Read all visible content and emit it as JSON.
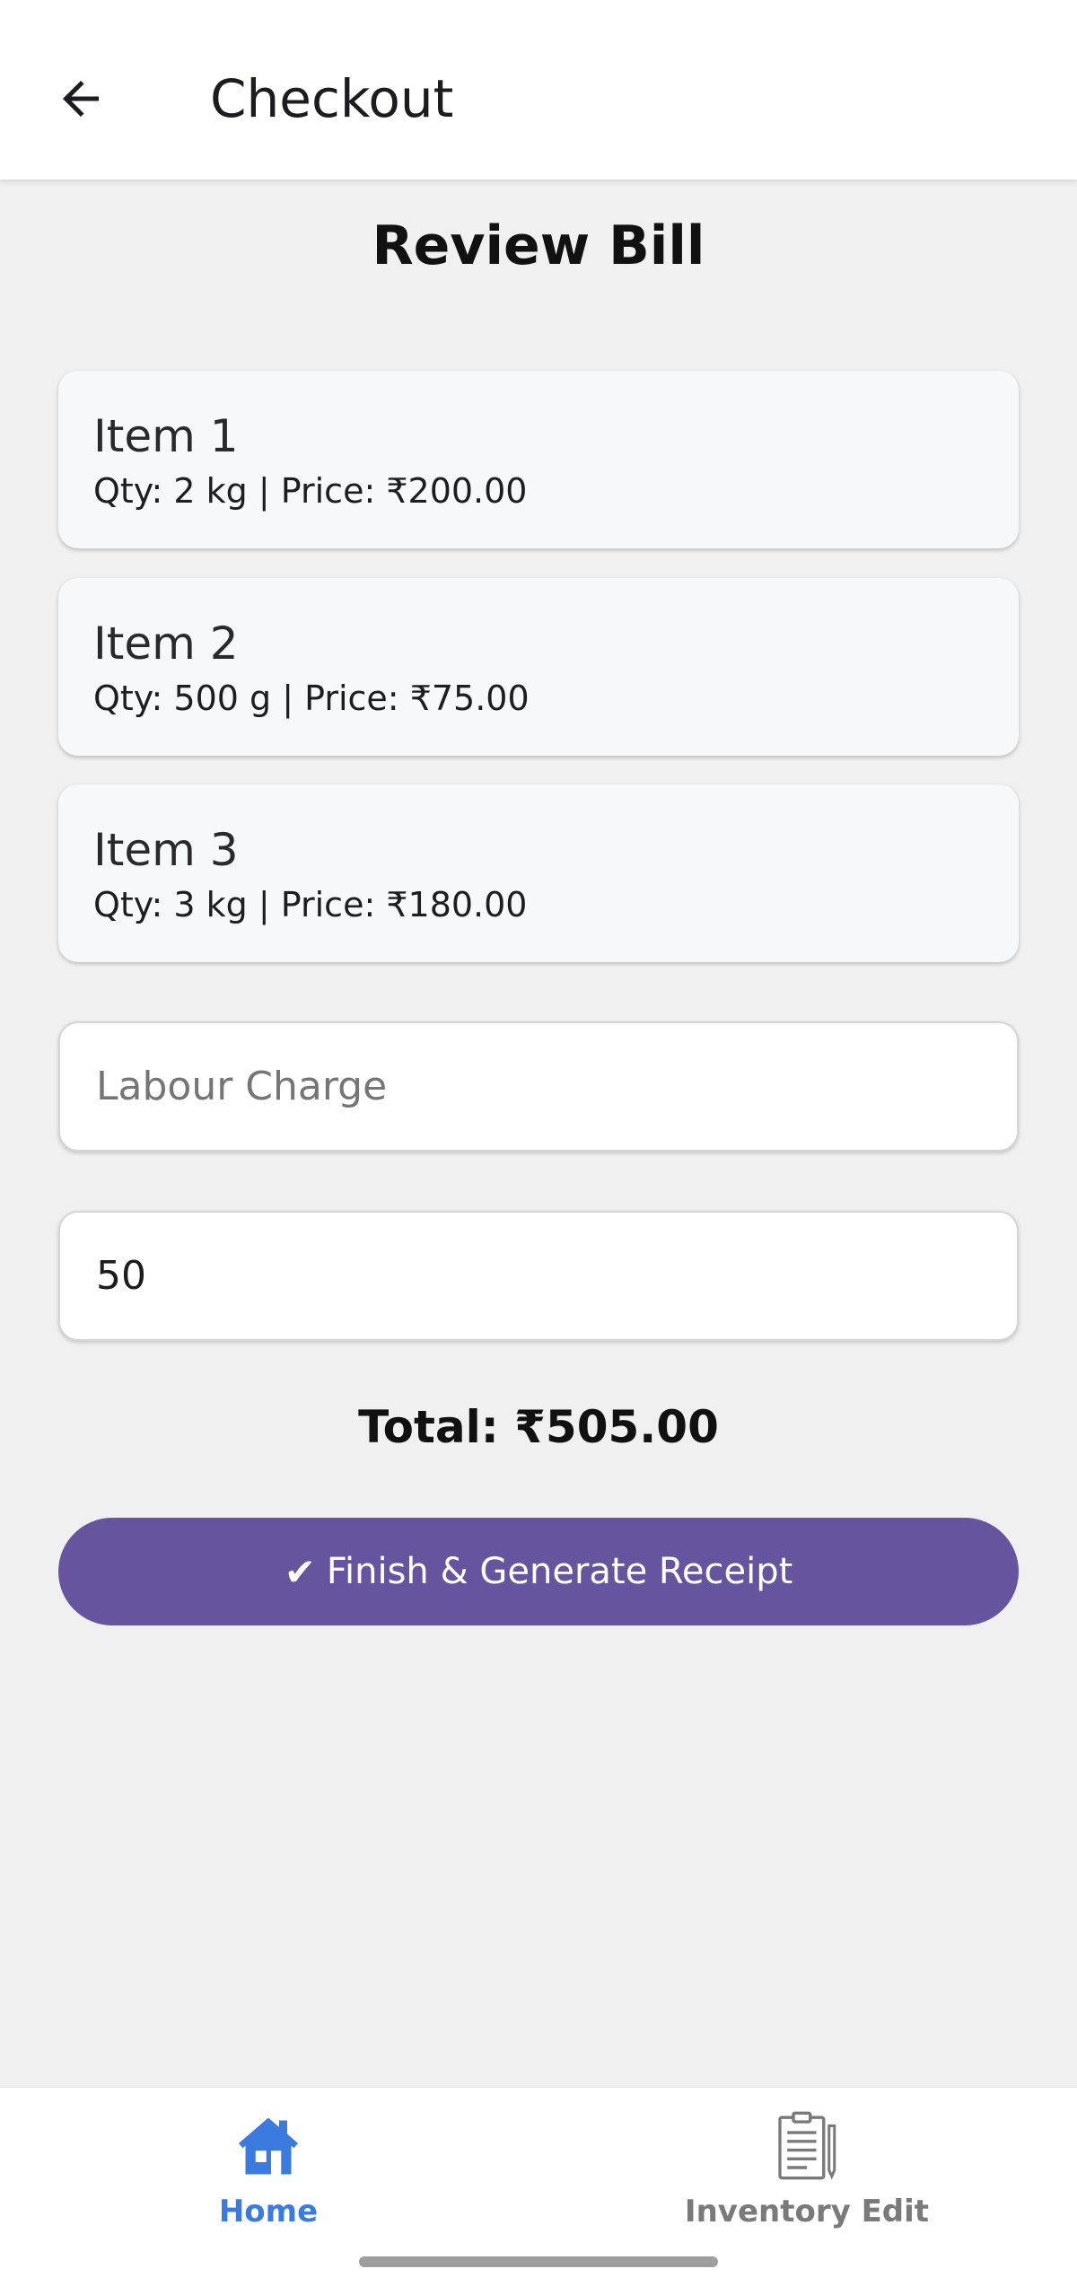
{
  "app_bar": {
    "title": "Checkout",
    "back_icon": "arrow-left-icon"
  },
  "page": {
    "heading": "Review Bill"
  },
  "items": [
    {
      "name": "Item 1",
      "detail": "Qty: 2 kg | Price: ₹200.00"
    },
    {
      "name": "Item 2",
      "detail": "Qty: 500 g | Price: ₹75.00"
    },
    {
      "name": "Item 3",
      "detail": "Qty: 3 kg | Price: ₹180.00"
    }
  ],
  "labour_charge": {
    "placeholder": "Labour Charge",
    "value": ""
  },
  "charge_value_field": {
    "value": "50"
  },
  "total": {
    "text": "Total: ₹505.00"
  },
  "finish_button": {
    "check_glyph": "✔",
    "label": "Finish & Generate Receipt",
    "color": "#66549f"
  },
  "bottom_nav": {
    "items": [
      {
        "label": "Home",
        "icon": "home-icon",
        "active": true,
        "color": "#3b7be0"
      },
      {
        "label": "Inventory Edit",
        "icon": "clipboard-icon",
        "active": false,
        "color": "#7a7a7a"
      }
    ]
  }
}
